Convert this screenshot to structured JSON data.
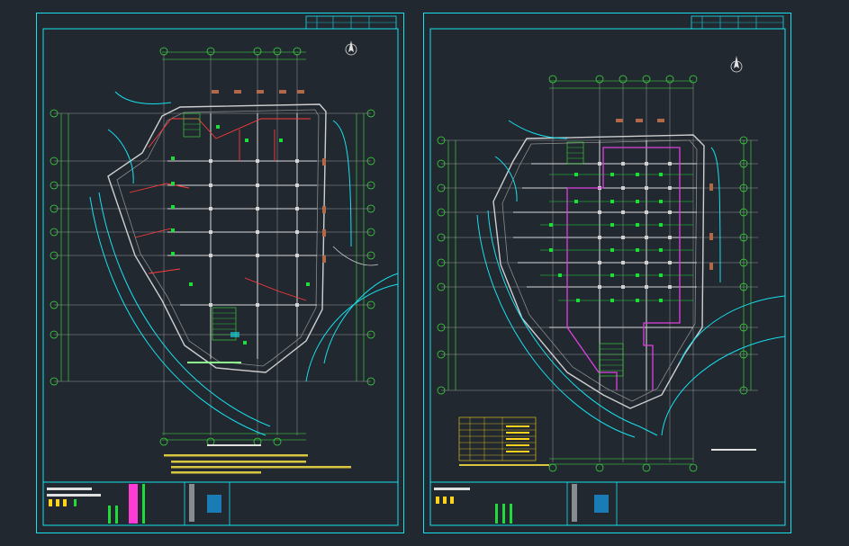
{
  "colors": {
    "background": "#212830",
    "frame": "#18e0ee",
    "dimension": "#3ee83e",
    "structure": "#bfbfbf",
    "circuit_red": "#ff3b3b",
    "circuit_magenta": "#e040e0",
    "device_green": "#1fdc3a"
  },
  "left_sheet": {
    "grid_x": [
      "①",
      "②",
      "③",
      "④",
      "⑤"
    ],
    "grid_y": [
      "⑥",
      "⑤",
      "④",
      "③",
      "②",
      "①",
      "Ⓒ",
      "Ⓑ",
      "Ⓐ"
    ],
    "icons": [
      "north-arrow-icon"
    ]
  },
  "right_sheet": {
    "grid_x": [
      "①",
      "②",
      "③",
      "④",
      "⑤",
      "⑥"
    ],
    "grid_y": [
      "⑥",
      "⑤",
      "④",
      "③",
      "②",
      "①",
      "Ⓒ",
      "Ⓑ",
      "Ⓐ"
    ],
    "icons": [
      "north-arrow-icon"
    ],
    "legend_rows": [
      "1",
      "2",
      "3",
      "4",
      "5",
      "6"
    ]
  }
}
